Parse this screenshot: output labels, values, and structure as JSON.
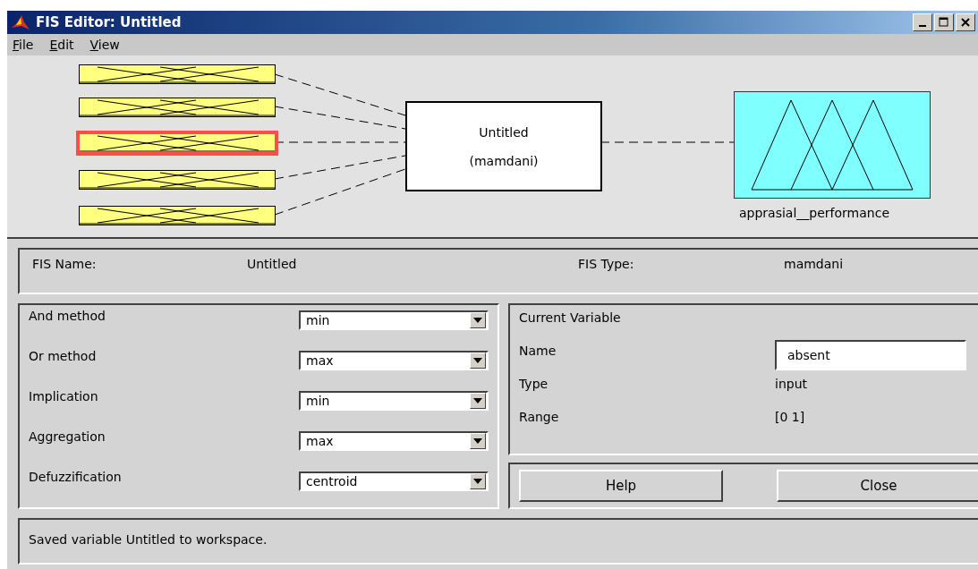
{
  "window": {
    "title": "FIS Editor: Untitled"
  },
  "menu": [
    {
      "label": "File"
    },
    {
      "label": "Edit"
    },
    {
      "label": "View"
    }
  ],
  "diagram": {
    "inputs": [
      {
        "selected": false
      },
      {
        "selected": false
      },
      {
        "selected": true
      },
      {
        "selected": false
      },
      {
        "selected": false
      }
    ],
    "system": {
      "name": "Untitled",
      "type": "(mamdani)"
    },
    "output": {
      "name": "apprasial__performance"
    }
  },
  "fis_info": {
    "name_label": "FIS Name:",
    "name_value": "Untitled",
    "type_label": "FIS Type:",
    "type_value": "mamdani"
  },
  "methods": [
    {
      "label": "And method",
      "value": "min"
    },
    {
      "label": "Or method",
      "value": "max"
    },
    {
      "label": "Implication",
      "value": "min"
    },
    {
      "label": "Aggregation",
      "value": "max"
    },
    {
      "label": "Defuzzification",
      "value": "centroid"
    }
  ],
  "current_variable": {
    "title": "Current Variable",
    "name_label": "Name",
    "name_value": "absent",
    "type_label": "Type",
    "type_value": "input",
    "range_label": "Range",
    "range_value": "[0 1]"
  },
  "buttons": [
    {
      "label": "Help"
    },
    {
      "label": "Close"
    }
  ],
  "status": "Saved variable Untitled to workspace."
}
